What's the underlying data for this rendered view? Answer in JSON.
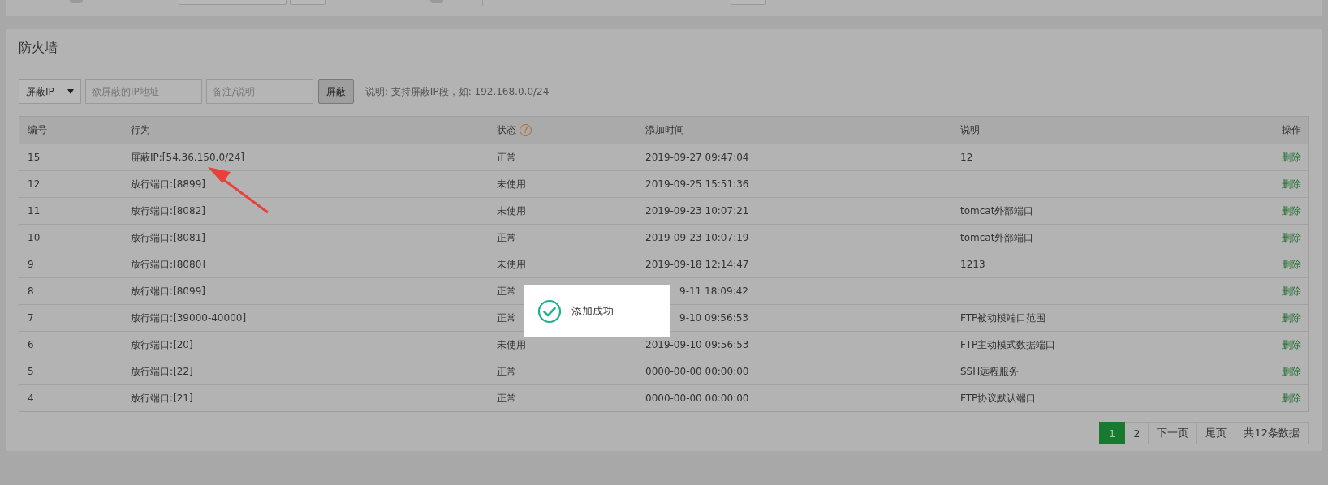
{
  "panel": {
    "title": "防火墙"
  },
  "toolbar": {
    "select": {
      "value": "屏蔽IP"
    },
    "ip_field": {
      "placeholder": "欲屏蔽的IP地址"
    },
    "note_field": {
      "placeholder": "备注/说明"
    },
    "button": "屏蔽",
    "hint": "说明: 支持屏蔽IP段，如: 192.168.0.0/24"
  },
  "table": {
    "columns": [
      "编号",
      "行为",
      "状态",
      "添加时间",
      "说明",
      "操作"
    ],
    "status_help": "?",
    "rows": [
      {
        "id": "15",
        "action": "屏蔽IP:[54.36.150.0/24]",
        "status": "正常",
        "time": "2019-09-27 09:47:04",
        "note": "12",
        "op": "删除",
        "time_covered": false
      },
      {
        "id": "12",
        "action": "放行端口:[8899]",
        "status": "未使用",
        "time": "2019-09-25 15:51:36",
        "op": "删除",
        "time_covered": false
      },
      {
        "id": "11",
        "action": "放行端口:[8082]",
        "status": "未使用",
        "time": "2019-09-23 10:07:21",
        "note": "tomcat外部端口",
        "op": "删除",
        "time_covered": false
      },
      {
        "id": "10",
        "action": "放行端口:[8081]",
        "status": "正常",
        "time": "2019-09-23 10:07:19",
        "note": "tomcat外部端口",
        "op": "删除",
        "time_covered": false
      },
      {
        "id": "9",
        "action": "放行端口:[8080]",
        "status": "未使用",
        "time": "2019-09-18 12:14:47",
        "note": "1213",
        "op": "删除",
        "time_covered": false
      },
      {
        "id": "8",
        "action": "放行端口:[8099]",
        "status": "正常",
        "time": "9-11 18:09:42",
        "op": "删除",
        "time_covered": true
      },
      {
        "id": "7",
        "action": "放行端口:[39000-40000]",
        "status": "正常",
        "time": "9-10 09:56:53",
        "note": "FTP被动模端口范围",
        "op": "删除",
        "time_covered": true
      },
      {
        "id": "6",
        "action": "放行端口:[20]",
        "status": "未使用",
        "time": "2019-09-10 09:56:53",
        "note": "FTP主动模式数据端口",
        "op": "删除",
        "time_covered": false
      },
      {
        "id": "5",
        "action": "放行端口:[22]",
        "status": "正常",
        "time": "0000-00-00 00:00:00",
        "note": "SSH远程服务",
        "op": "删除",
        "time_covered": false
      },
      {
        "id": "4",
        "action": "放行端口:[21]",
        "status": "正常",
        "time": "0000-00-00 00:00:00",
        "note": "FTP协议默认端口",
        "op": "删除",
        "time_covered": false
      }
    ]
  },
  "pagination": {
    "pages": [
      {
        "label": "1",
        "selected": true
      },
      {
        "label": "2",
        "selected": false
      }
    ],
    "next": "下一页",
    "last": "尾页",
    "total": "共12条数据"
  },
  "toast": {
    "message": "添加成功"
  }
}
